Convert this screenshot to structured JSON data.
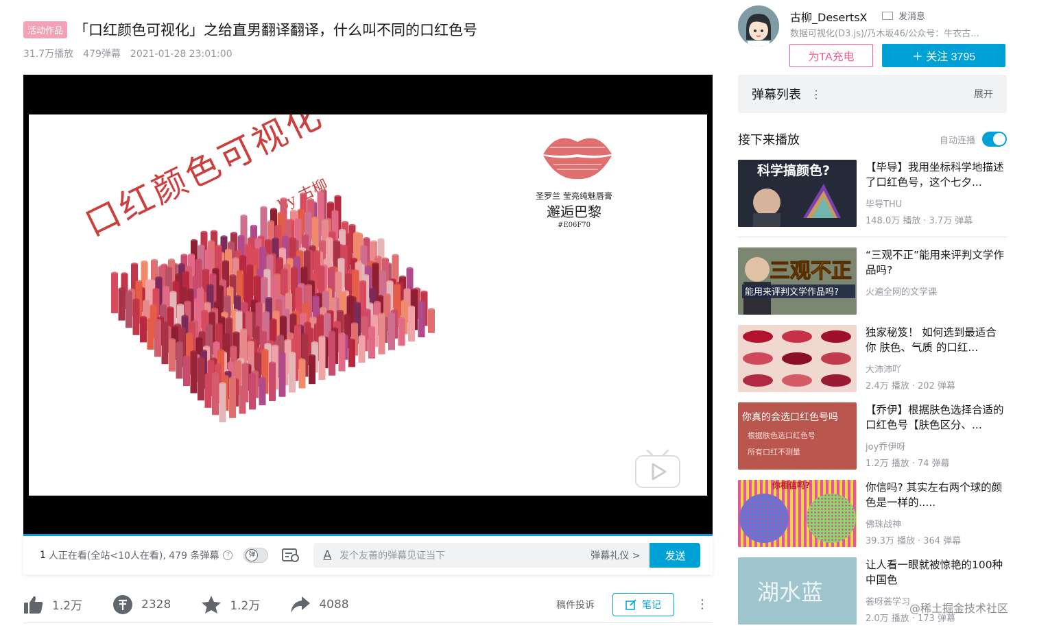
{
  "video": {
    "tag": "活动作品",
    "title": "「口红颜色可视化」之给直男翻译翻译，什么叫不同的口红色号",
    "views": "31.7万播放",
    "danmaku_count": "479弹幕",
    "date": "2021-01-28 23:01:00"
  },
  "slide": {
    "title": "口红颜色可视化",
    "by": "by 古柳",
    "lip_brand": "圣罗兰 莹亮纯魅唇膏",
    "lip_name": "邂逅巴黎",
    "lip_hex": "#E06F70"
  },
  "danmaku_bar": {
    "viewers_prefix": "1",
    "viewers_text": "人正在看(全站<10人在看), 479 条弹幕",
    "toggle_glyph": "弹",
    "input_placeholder": "发个友善的弹幕见证当下",
    "etiquette": "弹幕礼仪 >",
    "send": "发送"
  },
  "toolbar": {
    "like": "1.2万",
    "coin": "2328",
    "favorite": "1.2万",
    "share": "4088",
    "report": "稿件投诉",
    "note": "笔记"
  },
  "uploader": {
    "name": "古柳_DesertsX",
    "message": "发消息",
    "desc": "数据可视化(D3.js)/乃木坂46/公众号：牛衣古...",
    "charge": "为TA充电",
    "follow": "＋  关注 3795"
  },
  "danmaku_list": {
    "label": "弹幕列表",
    "expand": "展开"
  },
  "next_up": {
    "label": "接下来播放",
    "autoplay": "自动连播"
  },
  "recommendations": [
    {
      "title": "【毕导】我用坐标科学地描述了口红色号，这个七夕...",
      "up": "毕导THU",
      "views": "148.0万 播放",
      "danmaku": "3.7万 弹幕",
      "thumb_text": "科学搞颜色?"
    },
    {
      "title": "“三观不正”能用来评判文学作品吗?",
      "up": "火遍全网的文学课",
      "views": "",
      "danmaku": "",
      "thumb_text": "三观不正"
    },
    {
      "title": "独家秘笈！ 如何选到最适合你 肤色、气质 的口红...",
      "up": "大沛沛吖",
      "views": "2.4万 播放",
      "danmaku": "202 弹幕",
      "thumb_text": ""
    },
    {
      "title": "【乔伊】根据肤色选择合适的口红色号【肤色区分、...",
      "up": "joy乔伊呀",
      "views": "1.2万 播放",
      "danmaku": "74 弹幕",
      "thumb_text": "你真的会选口红色号吗"
    },
    {
      "title": "你信吗? 其实左右两个球的颜色是一样的.....",
      "up": "佛珠战神",
      "views": "39.3万 播放",
      "danmaku": "364 弹幕",
      "thumb_text": "你相信吗?"
    },
    {
      "title": "让人看一眼就被惊艳的100种中国色",
      "up": "荟呀荟学习",
      "views": "2.0万 播放",
      "danmaku": "173 弹幕",
      "thumb_text": "湖水蓝"
    }
  ],
  "watermark": "@稀土掘金技术社区",
  "colors": {
    "accent": "#00a1d6",
    "pink": "#f25d8e",
    "tag": "#f4a2b3"
  }
}
